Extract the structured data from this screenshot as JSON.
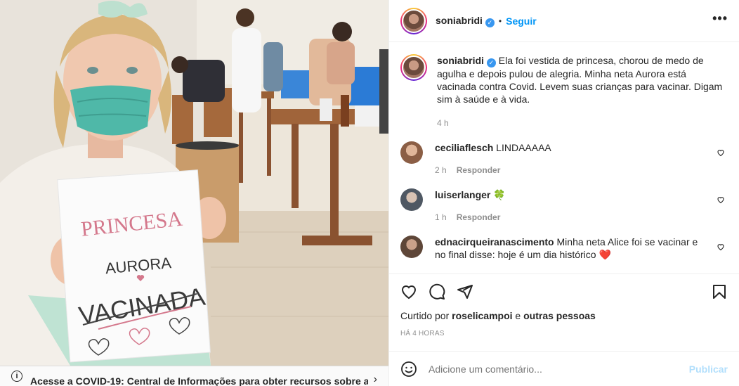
{
  "post": {
    "username": "soniabridi",
    "follow_label": "Seguir",
    "dot": "•",
    "more_label": "•••",
    "verified_mark": "✓"
  },
  "photo": {
    "sign_line1": "PRINCESA",
    "sign_line2": "AURORA",
    "sign_line3": "VACINADA"
  },
  "covid_banner": {
    "text": "Acesse a COVID-19: Central de Informações para obter recursos sobre a",
    "info_glyph": "i",
    "chevron": "›"
  },
  "caption": {
    "username": "soniabridi",
    "text": "Ela foi vestida de princesa, chorou de medo de agulha e depois pulou de alegria. Minha neta Aurora está vacinada contra Covid. Levem suas crianças para vacinar. Digam sim à saúde e à vida.",
    "time": "4 h"
  },
  "comments": [
    {
      "username": "ceciliaflesch",
      "text": "LINDAAAAA",
      "time": "2 h",
      "reply": "Responder",
      "avatar_color": "#b98a6a"
    },
    {
      "username": "luiserlanger",
      "text": "🍀",
      "time": "1 h",
      "reply": "Responder",
      "avatar_color": "#5a6470"
    },
    {
      "username": "ednacirqueiranascimento",
      "text": "Minha neta Alice foi se vacinar e no final disse: hoje é um dia histórico ❤️",
      "time": "",
      "reply": "",
      "avatar_color": "#6d5546"
    }
  ],
  "likes": {
    "prefix": "Curtido por",
    "user": "roselicampoi",
    "connector": "e",
    "others": "outras pessoas",
    "ago": "HÁ 4 HORAS"
  },
  "add_comment": {
    "placeholder": "Adicione um comentário...",
    "post_label": "Publicar"
  },
  "colors": {
    "accent": "#0095f6",
    "post_disabled": "#b2dffc",
    "verified": "#3897f0",
    "mask": "#4fb8a8"
  }
}
